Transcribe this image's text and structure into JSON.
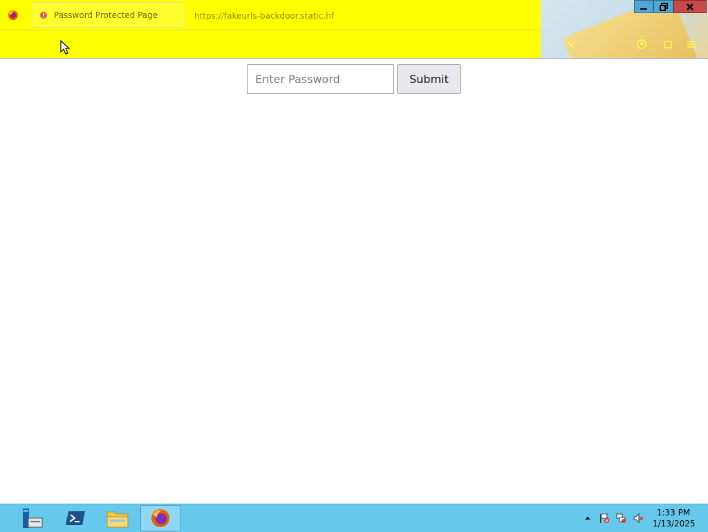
{
  "browser": {
    "tab": {
      "title": "Password Protected Page"
    },
    "url": "https://fakeurls-backdoor.static.hf",
    "theme": {
      "toolbar_color": "#ffff00"
    },
    "window_controls": {
      "minimize_icon": "minimize-icon",
      "restore_icon": "restore-icon",
      "close_icon": "close-icon"
    }
  },
  "page": {
    "password_input": {
      "placeholder": "Enter Password",
      "value": ""
    },
    "submit_button": {
      "label": "Submit"
    }
  },
  "taskbar": {
    "items": [
      {
        "name": "server-manager",
        "icon": "server-manager-icon",
        "active": false
      },
      {
        "name": "powershell",
        "icon": "powershell-icon",
        "active": false
      },
      {
        "name": "file-explorer",
        "icon": "folder-icon",
        "active": false
      },
      {
        "name": "firefox",
        "icon": "firefox-icon",
        "active": true
      }
    ],
    "clock": {
      "time": "1:33 PM",
      "date": "1/13/2025"
    }
  }
}
